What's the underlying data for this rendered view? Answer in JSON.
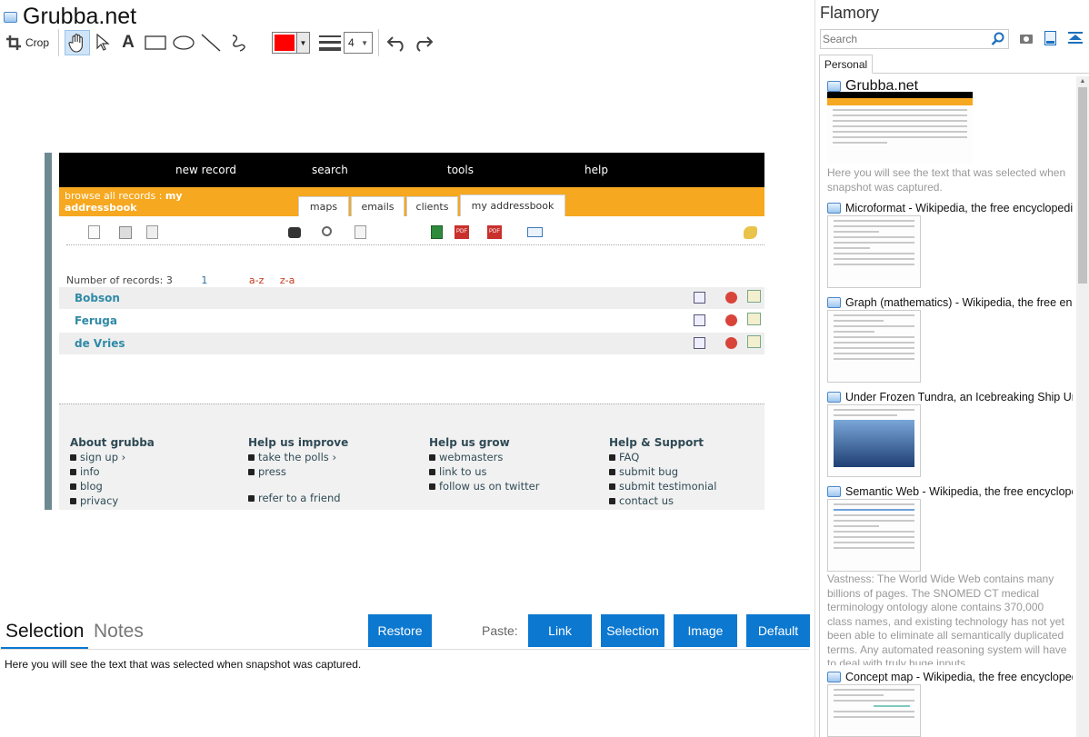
{
  "window": {
    "title": "Grubba.net"
  },
  "toolbar": {
    "crop_label": "Crop",
    "line_width": "4"
  },
  "colors": {
    "accent": "#0c78d0",
    "pen_color": "#ff0000",
    "header_black": "#000000",
    "header_orange": "#f6a820",
    "link_teal": "#2f8aa7"
  },
  "snapshot": {
    "nav": [
      "new record",
      "search",
      "tools",
      "help"
    ],
    "breadcrumb_prefix": "browse all records : ",
    "breadcrumb_current": "my addressbook",
    "tabs": [
      "maps",
      "emails",
      "clients",
      "my addressbook"
    ],
    "records_label": "Number of records: 3",
    "page_number": "1",
    "sort_az": "a-z",
    "sort_za": "z-a",
    "records": [
      "Bobson",
      "Feruga",
      "de Vries"
    ],
    "footer": [
      {
        "title": "About grubba",
        "links": [
          "sign up ›",
          "info",
          "blog",
          "privacy"
        ]
      },
      {
        "title": "Help us improve",
        "links": [
          "take the polls ›",
          "press",
          "",
          "refer to a friend"
        ]
      },
      {
        "title": "Help us grow",
        "links": [
          "webmasters",
          "link to us",
          "follow us on twitter"
        ]
      },
      {
        "title": "Help & Support",
        "links": [
          "FAQ",
          "submit bug",
          "submit testimonial",
          "contact us"
        ]
      }
    ]
  },
  "bottom": {
    "tabs": [
      "Selection",
      "Notes"
    ],
    "restore_label": "Restore",
    "paste_label": "Paste:",
    "paste_buttons": [
      "Link",
      "Selection",
      "Image",
      "Default"
    ],
    "selection_text": "Here you will see the text that was selected when snapshot was captured."
  },
  "sidebar": {
    "app_title": "Flamory",
    "search_placeholder": "Search",
    "tab": "Personal",
    "items": [
      {
        "title": "Grubba.net",
        "desc": "Here you will see the text that was selected when snapshot was captured."
      },
      {
        "title": "Microformat - Wikipedia, the free encyclopedia",
        "desc": ""
      },
      {
        "title": "Graph (mathematics) - Wikipedia, the free encyclopedia",
        "desc": ""
      },
      {
        "title": "Under Frozen Tundra, an Icebreaking Ship Uncovers",
        "desc": ""
      },
      {
        "title": "Semantic Web - Wikipedia, the free encyclopedia",
        "desc": "Vastness: The World Wide Web contains many billions of pages. The SNOMED CT medical terminology ontology alone contains 370,000 class names, and existing technology has not yet been able to eliminate all semantically duplicated terms. Any automated reasoning system will have to deal with truly huge inputs."
      },
      {
        "title": "Concept map - Wikipedia, the free encyclopedia",
        "desc": ""
      }
    ]
  }
}
